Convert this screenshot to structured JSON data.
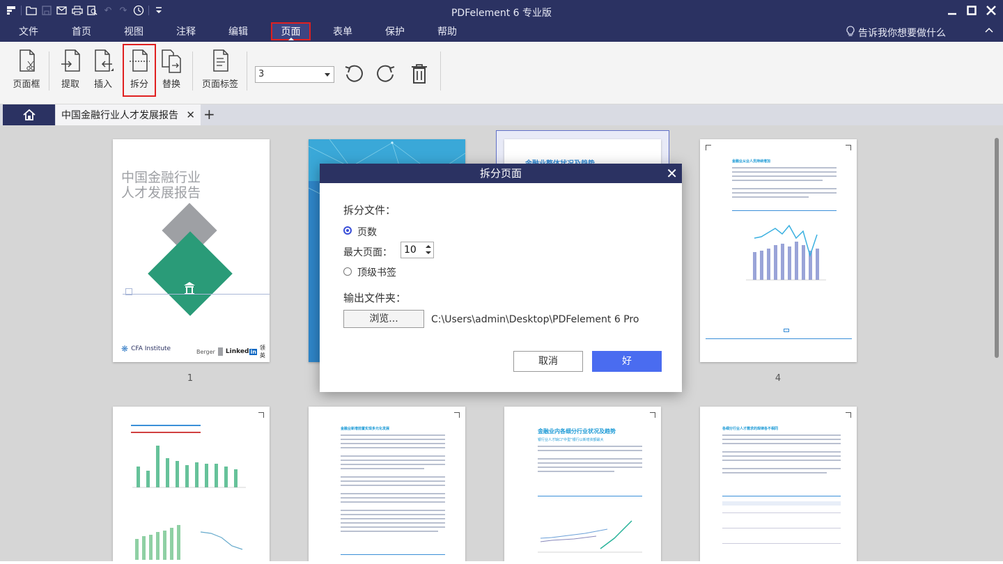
{
  "titlebar": {
    "title": "PDFelement  6  专业版",
    "quick_access": [
      "app-logo-icon",
      "open-icon",
      "save-icon",
      "email-icon",
      "print-icon",
      "print-preview-icon",
      "undo-icon",
      "redo-icon",
      "history-icon",
      "customize-icon"
    ]
  },
  "menubar": {
    "items": [
      "文件",
      "首页",
      "视图",
      "注释",
      "编辑",
      "页面",
      "表单",
      "保护",
      "帮助"
    ],
    "active": "页面",
    "help_placeholder": "告诉我你想要做什么"
  },
  "ribbon": {
    "crop_label": "页面框",
    "extract_label": "提取",
    "insert_label": "插入",
    "split_label": "拆分",
    "replace_label": "替换",
    "page_label_label": "页面标签",
    "page_select_value": "3"
  },
  "tabs": {
    "doc_title": "中国金融行业人才发展报告"
  },
  "pages": {
    "numbers": [
      "1",
      "4"
    ],
    "cover_title_line1": "中国金融行业",
    "cover_title_line2": "人才发展报告",
    "cover_logo_cfa": "CFA Institute",
    "cover_logo_berger": "Berger",
    "cover_logo_linkedin": "Linked",
    "cover_logo_linkedin_in": "in",
    "cover_logo_linkedin_cn": "领英",
    "page3_title": "金融业整体状况及趋势",
    "page4_title": "金融业从业人员持续增加",
    "page6_title": "金融业新增前置实现多元化发展",
    "page7_title": "金融业内各细分行业状况及趋势",
    "page7_subtitle": "银行业人才缺口\"中型\"银行以新增资额最大",
    "page8_title": "各细分行业人才需求的规律各不相同"
  },
  "dialog": {
    "title": "拆分页面",
    "split_files_label": "拆分文件：",
    "option_pages": "页数",
    "max_pages_label": "最大页面：",
    "max_pages_value": "10",
    "option_bookmarks": "顶级书签",
    "output_folder_label": "输出文件夹：",
    "browse_label": "浏览...",
    "output_path": "C:\\Users\\admin\\Desktop\\PDFelement 6 Pro",
    "cancel_label": "取消",
    "ok_label": "好"
  },
  "colors": {
    "titlebar_bg": "#2b3262",
    "accent_blue": "#4a6cf0",
    "highlight_red": "#e02020",
    "cover_green": "#2a9b78",
    "cover_gray": "#9ea0a4"
  }
}
